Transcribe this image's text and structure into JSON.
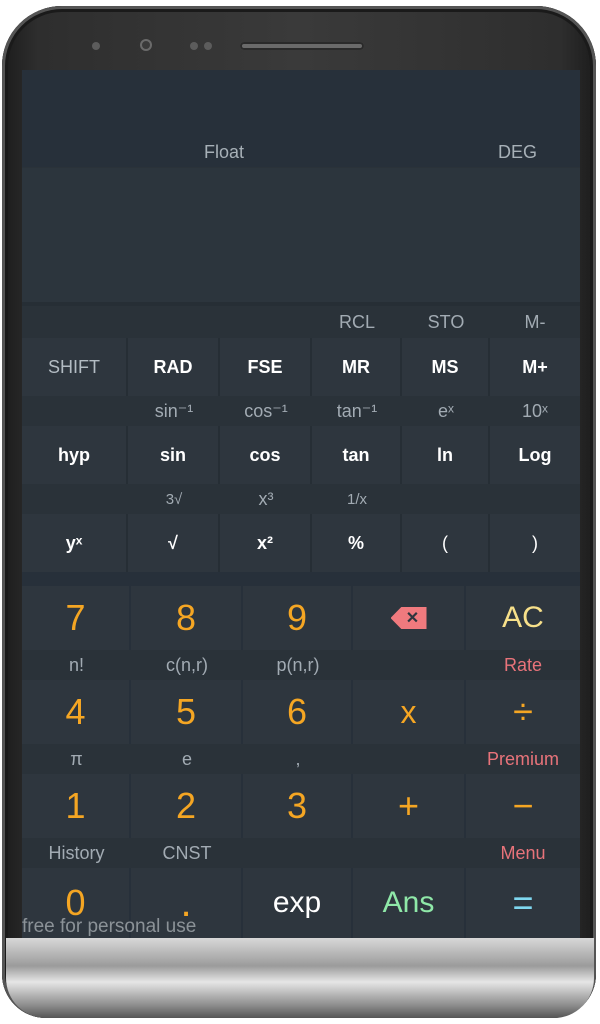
{
  "display": {
    "mode": "Float",
    "angle": "DEG"
  },
  "memory_sub": [
    "",
    "",
    "",
    "RCL",
    "STO",
    "M-"
  ],
  "row_shift": [
    "SHIFT",
    "RAD",
    "FSE",
    "MR",
    "MS",
    "M+"
  ],
  "trig_sub": [
    "",
    "sin⁻¹",
    "cos⁻¹",
    "tan⁻¹",
    "eˣ",
    "10ˣ"
  ],
  "row_trig": [
    "hyp",
    "sin",
    "cos",
    "tan",
    "ln",
    "Log"
  ],
  "pow_sub": [
    "",
    "3√",
    "x³",
    "1/x",
    "",
    ""
  ],
  "row_pow": [
    "yˣ",
    "√",
    "x²",
    "%",
    "(",
    ")"
  ],
  "row_789": [
    "7",
    "8",
    "9",
    "",
    "AC"
  ],
  "sub_456": [
    "n!",
    "c(n,r)",
    "p(n,r)",
    "",
    "Rate"
  ],
  "row_456": [
    "4",
    "5",
    "6",
    "x",
    "÷"
  ],
  "sub_123": [
    "π",
    "e",
    ",",
    "",
    "Premium"
  ],
  "row_123": [
    "1",
    "2",
    "3",
    "+",
    "−"
  ],
  "sub_0": [
    "History",
    "CNST",
    "",
    "",
    "Menu"
  ],
  "row_0": [
    "0",
    ".",
    "exp",
    "Ans",
    "="
  ],
  "watermark": "free for personal use",
  "icons": {
    "delete": "backspace-icon"
  },
  "colors": {
    "digit": "#f5a623",
    "ac": "#f7e08a",
    "ans": "#8fe8a8",
    "equals": "#7fd8f0",
    "accent": "#e8737a"
  }
}
